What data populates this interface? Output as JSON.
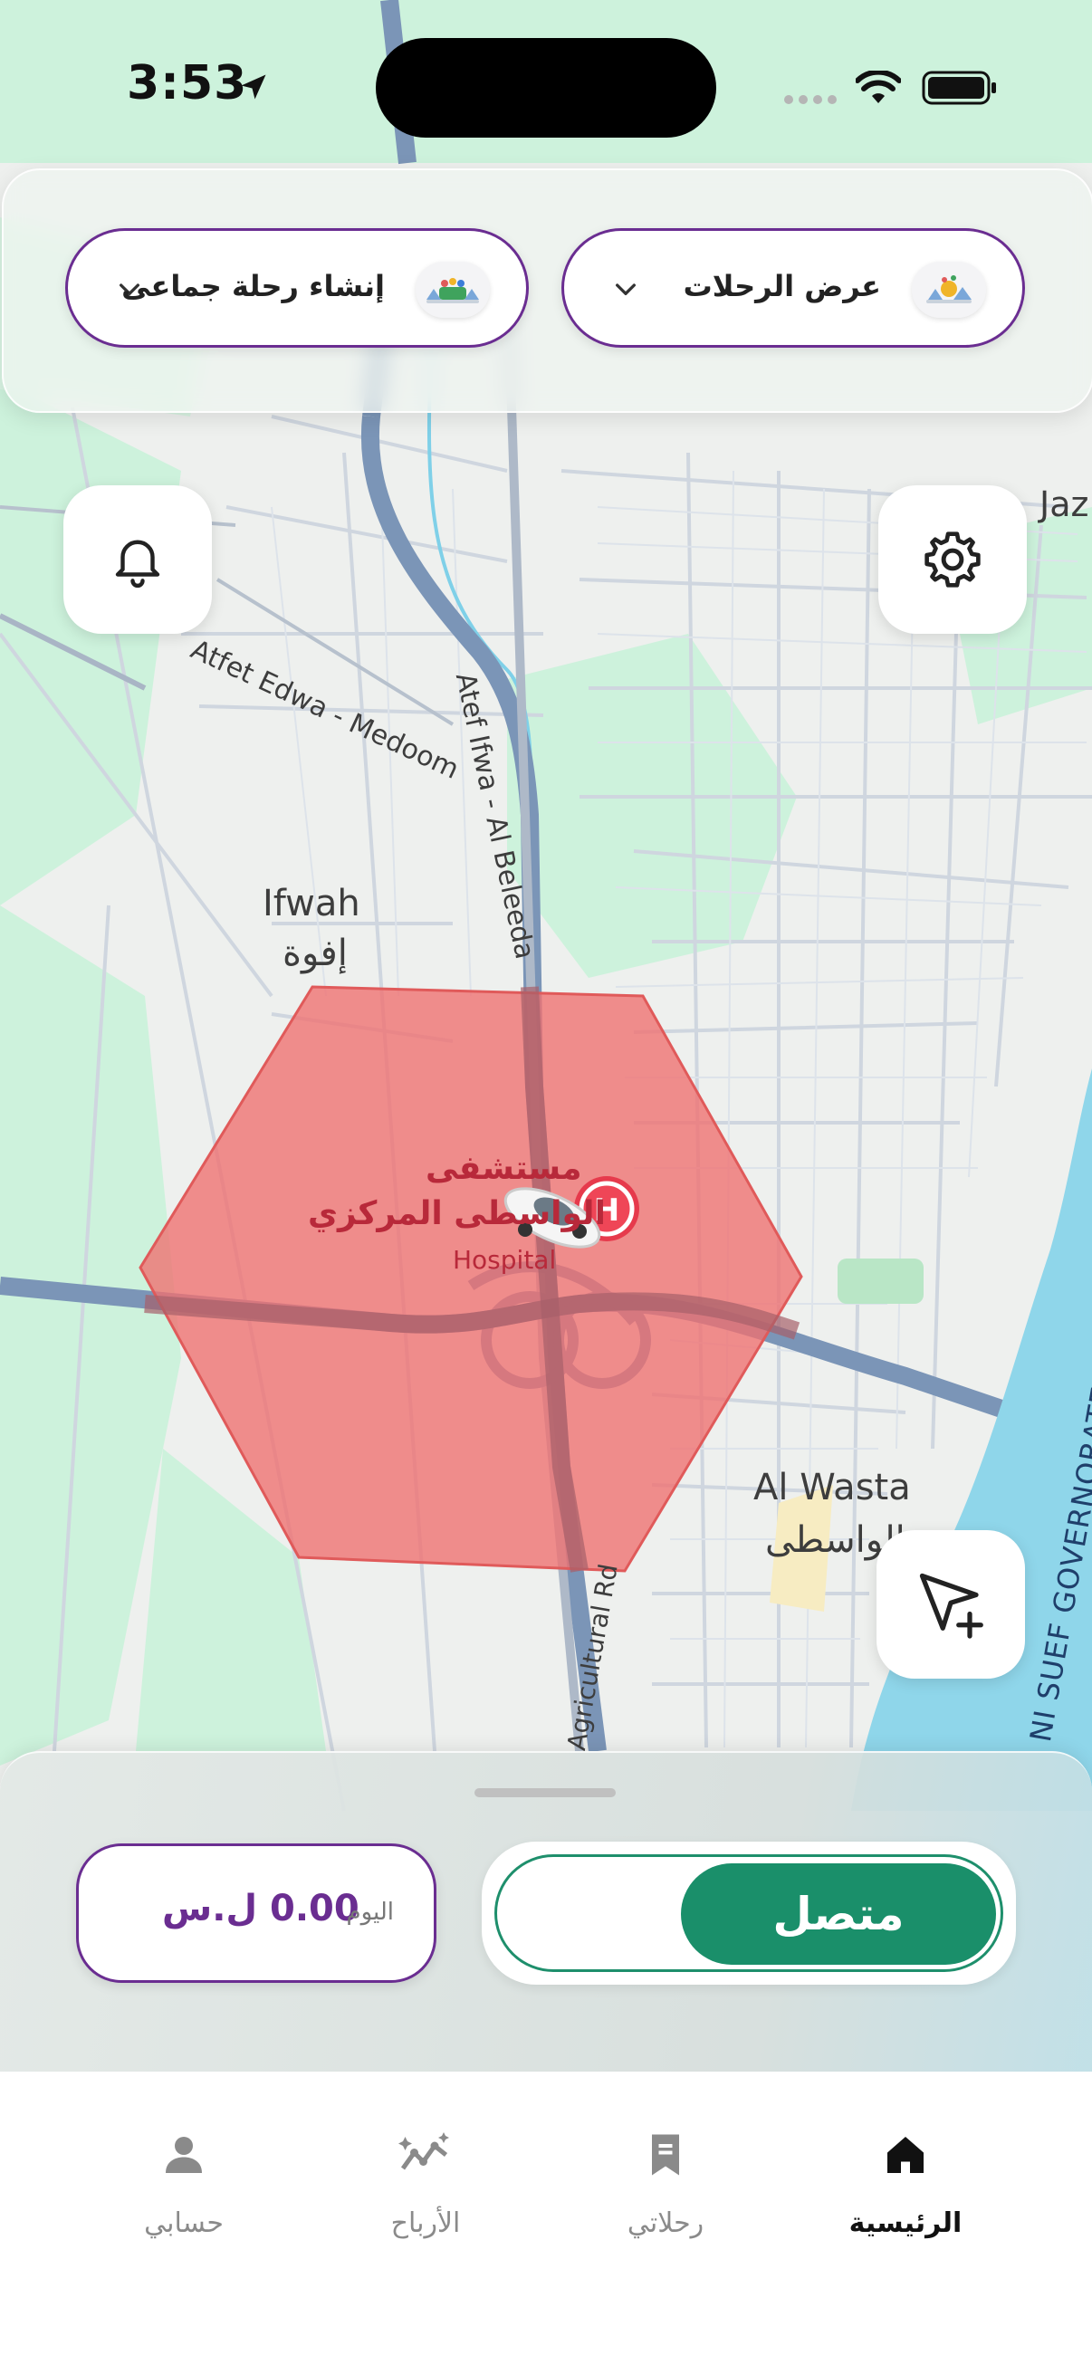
{
  "status_bar": {
    "time": "3:53"
  },
  "top_actions": {
    "view_trips": {
      "label": "عرض الرحلات",
      "icon": "trips-emoji-icon"
    },
    "create_group_trip": {
      "label": "إنشاء رحلة جماعى",
      "icon": "group-emoji-icon"
    }
  },
  "map": {
    "labels": {
      "atfet_edwa": "Atfet Edwa - Medoom",
      "atef_ifwa": "Atef Ifwa - Al Beleeda",
      "ifwah_en": "Ifwah",
      "ifwah_ar": "إفوة",
      "hospital_ar_1": "مستشفى",
      "hospital_ar_2": "الواسطى المركزي",
      "hospital_en": "Hospital",
      "al_wasta_en": "Al Wasta",
      "al_wasta_ar": "الواسطى",
      "agri_rd": "Agricultural Rd",
      "governorate": "NI SUEF GOVERNORATE",
      "jaz": "Jaz"
    },
    "zone_color": "#f07070",
    "water_color": "#8fd6ea",
    "green_color": "#cdf2dc"
  },
  "bottom_sheet": {
    "status_toggle": {
      "label": "متصل",
      "state": "online"
    },
    "earnings": {
      "label": "اليوم",
      "amount": "0.00 ل.س"
    }
  },
  "tabs": [
    {
      "label": "الرئيسية",
      "icon": "home-icon",
      "active": true
    },
    {
      "label": "رحلاتي",
      "icon": "trips-icon",
      "active": false
    },
    {
      "label": "الأرباح",
      "icon": "earnings-icon",
      "active": false
    },
    {
      "label": "حسابي",
      "icon": "account-icon",
      "active": false
    }
  ],
  "colors": {
    "brand_purple": "#6a2d91",
    "online_green": "#1a8f6a"
  }
}
